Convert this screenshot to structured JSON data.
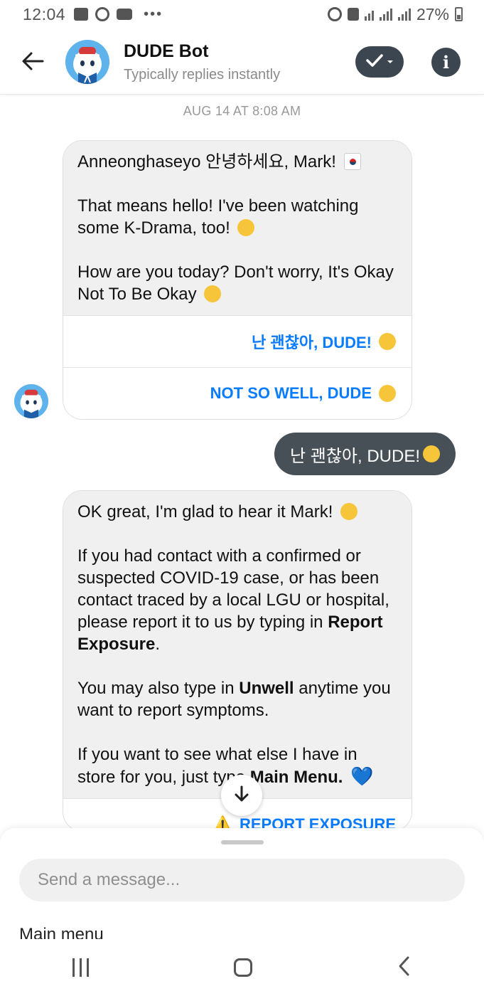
{
  "status_bar": {
    "time": "12:04",
    "battery": "27%"
  },
  "header": {
    "title": "DUDE Bot",
    "subtitle": "Typically replies instantly",
    "info_glyph": "i"
  },
  "timestamp": "AUG 14 AT 8:08 AM",
  "messages": {
    "bot1": {
      "line1": "Anneonghaseyo 안녕하세요, Mark!",
      "line2": "That means hello! I've been watching some K-Drama, too!",
      "line3": "How are you today? Don't worry, It's Okay Not To Be Okay",
      "reply1": "난 괜찮아, DUDE!",
      "reply2": "NOT SO WELL, DUDE"
    },
    "user1": "난 괜찮아, DUDE!",
    "bot2": {
      "p1": "OK great, I'm glad to hear it Mark!",
      "p2_a": "If you had contact with a confirmed or suspected COVID-19 case, or has been contact traced by a local LGU or hospital, please report it to us by typing in ",
      "p2_bold": "Report Exposure",
      "p2_b": ".",
      "p3_a": "You may also type in ",
      "p3_bold": "Unwell",
      "p3_b": " anytime you want to report symptoms.",
      "p4_a": "If you want to see what else I have in store for you, just type ",
      "p4_bold": "Main Menu.",
      "reply1": "REPORT EXPOSURE"
    }
  },
  "composer": {
    "placeholder": "Send a message...",
    "quick_action": "Main menu"
  },
  "icons": {
    "back": "arrow-left-icon",
    "check": "check-icon",
    "info": "info-icon",
    "scroll": "arrow-down-icon",
    "warning_glyph": "⚠️",
    "heart_glyph": "💙"
  },
  "colors": {
    "link_blue": "#0a7cff",
    "dark_pill": "#3c4650",
    "user_bubble": "#474f57",
    "bot_bubble": "#f0f0f0"
  }
}
